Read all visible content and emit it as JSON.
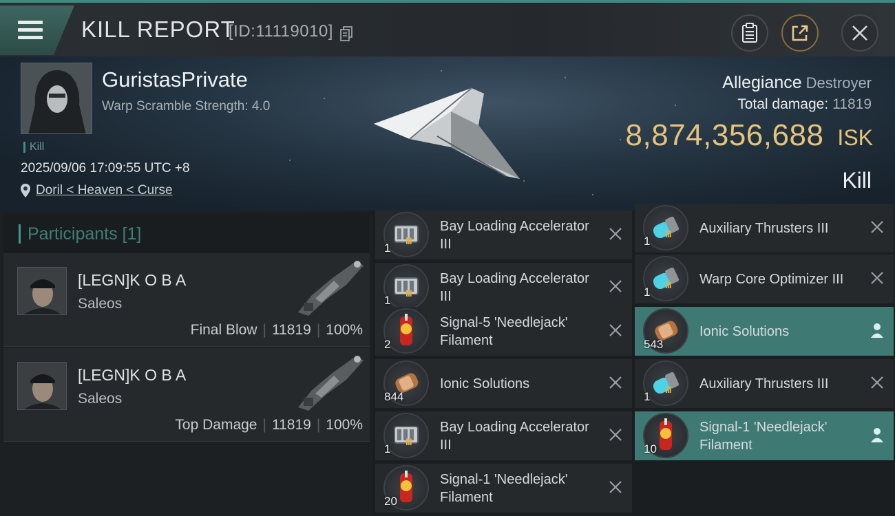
{
  "header": {
    "title": "KILL REPORT",
    "id_text": "[ID:11119010]",
    "icons": {
      "menu": "hamburger-menu-icon",
      "copy": "copy-icon",
      "clipboard": "clipboard-icon",
      "share": "share-icon",
      "close": "close-icon"
    }
  },
  "victim": {
    "name": "GuristasPrivate",
    "subtitle": "Warp Scramble Strength: 4.0",
    "tag": "Kill",
    "time": "2025/09/06 17:09:55 UTC +8",
    "location": "Doril < Heaven < Curse",
    "allegiance_label": "Allegiance",
    "allegiance_value": "Destroyer",
    "damage_label": "Total damage:",
    "damage_value": "11819",
    "isk_value": "8,874,356,688",
    "isk_unit": "ISK",
    "result": "Kill"
  },
  "participants": {
    "title": "Participants [1]",
    "items": [
      {
        "name": "[LEGN]K O B A",
        "ship": "Saleos",
        "role": "Final Blow",
        "damage": "11819",
        "percent": "100%"
      },
      {
        "name": "[LEGN]K O B A",
        "ship": "Saleos",
        "role": "Top Damage",
        "damage": "11819",
        "percent": "100%"
      }
    ]
  },
  "items_col1": [
    {
      "qty": "1",
      "name": "Bay Loading Accelerator III",
      "kind": "module",
      "state": "destroyed"
    },
    {
      "qty": "1",
      "name": "Bay Loading Accelerator III",
      "kind": "module",
      "state": "destroyed"
    },
    {
      "qty": "2",
      "name": "Signal-5 'Needlejack' Filament",
      "kind": "filament",
      "state": "destroyed"
    },
    {
      "qty": "844",
      "name": "Ionic Solutions",
      "kind": "canister",
      "state": "destroyed"
    },
    {
      "qty": "1",
      "name": "Bay Loading Accelerator III",
      "kind": "module",
      "state": "destroyed"
    },
    {
      "qty": "20",
      "name": "Signal-1 'Needlejack' Filament",
      "kind": "filament",
      "state": "destroyed"
    }
  ],
  "items_col2": [
    {
      "qty": "1",
      "name": "Auxiliary Thrusters III",
      "kind": "thruster",
      "state": "destroyed"
    },
    {
      "qty": "1",
      "name": "Warp Core Optimizer III",
      "kind": "thruster",
      "state": "destroyed"
    },
    {
      "qty": "543",
      "name": "Ionic Solutions",
      "kind": "canister",
      "state": "dropped"
    },
    {
      "qty": "1",
      "name": "Auxiliary Thrusters III",
      "kind": "thruster",
      "state": "destroyed"
    },
    {
      "qty": "10",
      "name": "Signal-1 'Needlejack' Filament",
      "kind": "filament",
      "state": "dropped"
    }
  ],
  "colors": {
    "accent": "#3e7a73",
    "isk": "#e6c37a",
    "header_border": "#3c8a80"
  }
}
